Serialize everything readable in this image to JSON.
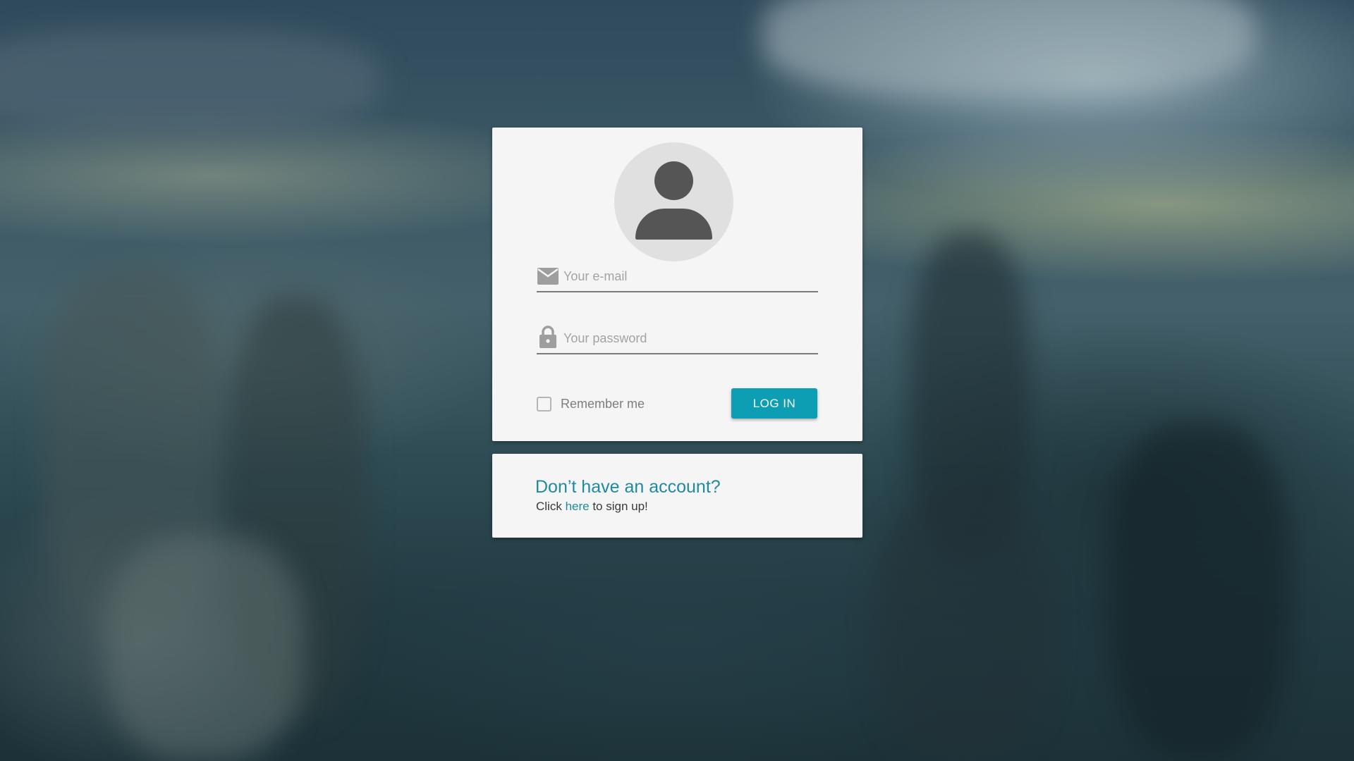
{
  "background": {
    "description": "blurred city skyline photo"
  },
  "login": {
    "avatar_icon": "user-silhouette-icon",
    "email": {
      "icon": "mail-icon",
      "placeholder": "Your e-mail",
      "value": ""
    },
    "password": {
      "icon": "lock-icon",
      "placeholder": "Your password",
      "value": ""
    },
    "remember": {
      "label": "Remember me",
      "checked": false
    },
    "button_label": "LOG IN"
  },
  "signup": {
    "heading": "Don’t have an account?",
    "text_before": "Click ",
    "link_text": "here",
    "text_after": " to sign up!"
  },
  "colors": {
    "accent": "#0e9eb4",
    "link": "#1f8aa0",
    "card": "#f5f5f5",
    "icon_gray": "#9e9e9e",
    "avatar_bg": "#e0e0e0",
    "avatar_fg": "#555555"
  }
}
